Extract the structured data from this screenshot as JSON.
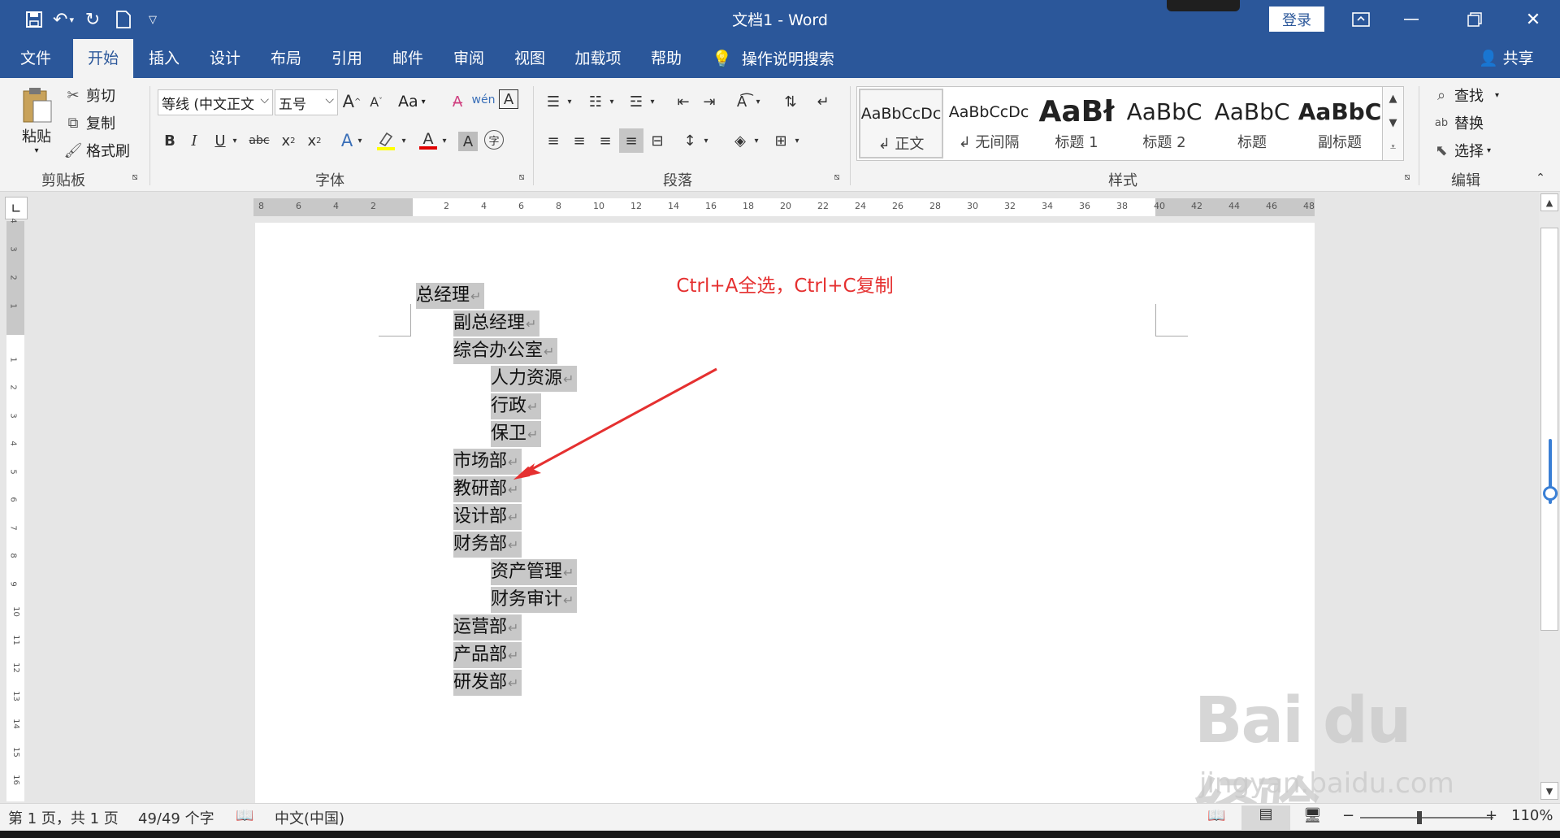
{
  "titlebar": {
    "title": "文档1 - Word",
    "login": "登录"
  },
  "tabs": [
    "文件",
    "开始",
    "插入",
    "设计",
    "布局",
    "引用",
    "邮件",
    "审阅",
    "视图",
    "加载项",
    "帮助"
  ],
  "search": {
    "label": "操作说明搜索"
  },
  "share": "共享",
  "clipboard": {
    "paste": "粘贴",
    "cut": "剪切",
    "copy": "复制",
    "format_painter": "格式刷",
    "group": "剪贴板"
  },
  "font": {
    "name": "等线 (中文正文",
    "size": "五号",
    "case_label": "Aa",
    "group": "字体"
  },
  "paragraph": {
    "group": "段落"
  },
  "styles": {
    "group": "样式",
    "items": [
      {
        "sample": "AaBbCcDc",
        "name": "正文"
      },
      {
        "sample": "AaBbCcDc",
        "name": "无间隔"
      },
      {
        "sample": "AaBł",
        "name": "标题 1"
      },
      {
        "sample": "AaBbC",
        "name": "标题 2"
      },
      {
        "sample": "AaBbC",
        "name": "标题"
      },
      {
        "sample": "AaBbC",
        "name": "副标题"
      }
    ]
  },
  "editing": {
    "find": "查找",
    "replace": "替换",
    "select": "选择",
    "group": "编辑"
  },
  "document": {
    "annotation": "Ctrl+A全选，Ctrl+C复制",
    "lines": [
      {
        "text": "总经理",
        "level": 0
      },
      {
        "text": "副总经理",
        "level": 1
      },
      {
        "text": "综合办公室",
        "level": 1
      },
      {
        "text": "人力资源",
        "level": 2
      },
      {
        "text": "行政",
        "level": 2
      },
      {
        "text": "保卫",
        "level": 2
      },
      {
        "text": "市场部",
        "level": 1
      },
      {
        "text": "教研部",
        "level": 1
      },
      {
        "text": "设计部",
        "level": 1
      },
      {
        "text": "财务部",
        "level": 1
      },
      {
        "text": "资产管理",
        "level": 2
      },
      {
        "text": "财务审计",
        "level": 2
      },
      {
        "text": "运营部",
        "level": 1
      },
      {
        "text": "产品部",
        "level": 1
      },
      {
        "text": "研发部",
        "level": 1
      }
    ]
  },
  "ruler": {
    "h_left": [
      "8",
      "6",
      "4",
      "2"
    ],
    "h_right": [
      "2",
      "4",
      "6",
      "8",
      "10",
      "12",
      "14",
      "16",
      "18",
      "20",
      "22",
      "24",
      "26",
      "28",
      "30",
      "32",
      "34",
      "36",
      "38",
      "40",
      "42",
      "44",
      "46",
      "48"
    ],
    "v_top": [
      "4",
      "3",
      "2",
      "1"
    ],
    "v_bottom": [
      "1",
      "2",
      "3",
      "4",
      "5",
      "6",
      "7",
      "8",
      "9",
      "10",
      "11",
      "12",
      "13",
      "14",
      "15",
      "16"
    ]
  },
  "statusbar": {
    "page": "第 1 页，共 1 页",
    "words": "49/49 个字",
    "language": "中文(中国)",
    "zoom": "110%"
  },
  "watermark": {
    "logo": "Bai du 经验",
    "url": "jingyan.baidu.com"
  },
  "colors": {
    "brand": "#2b579a",
    "annotation": "#e53030",
    "selection": "#c8c8c8"
  }
}
